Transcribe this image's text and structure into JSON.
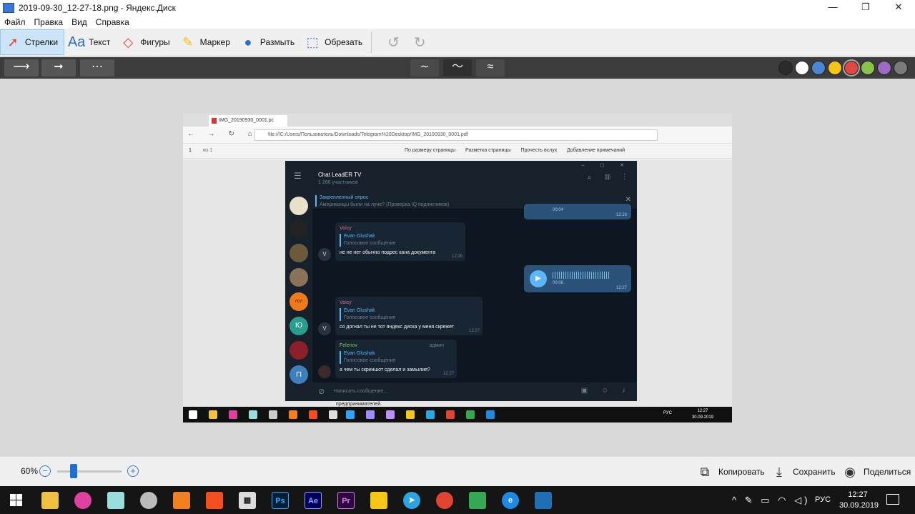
{
  "window": {
    "title": "2019-09-30_12-27-18.png - Яндекс.Диск",
    "controls": [
      "—",
      "❐",
      "✕"
    ]
  },
  "menu": [
    "Файл",
    "Правка",
    "Вид",
    "Справка"
  ],
  "toolbar": {
    "tools": [
      {
        "label": "Стрелки",
        "icon": "arrow-icon",
        "active": true
      },
      {
        "label": "Текст",
        "icon": "text-icon",
        "active": false
      },
      {
        "label": "Фигуры",
        "icon": "shapes-icon",
        "active": false
      },
      {
        "label": "Маркер",
        "icon": "marker-icon",
        "active": false
      },
      {
        "label": "Размыть",
        "icon": "blur-icon",
        "active": false
      },
      {
        "label": "Обрезать",
        "icon": "crop-icon",
        "active": false
      }
    ],
    "undo_icon": "undo-icon",
    "redo_icon": "redo-icon"
  },
  "options": {
    "arrow_styles": [
      "arrow-style-thin",
      "arrow-style-thick",
      "arrow-style-dotted"
    ],
    "stroke_widths": [
      "thin",
      "medium",
      "thick"
    ],
    "selected_width": "medium",
    "colors": [
      "#2b2b2b",
      "#ffffff",
      "#4a86d4",
      "#f5c518",
      "#e04848",
      "#8bc34a",
      "#9c6bc4",
      "#7a7a7a"
    ],
    "selected_color": "#e04848"
  },
  "screenshot": {
    "browser_tab": "IMG_20190930_0001.pc",
    "url": "file:///C:/Users/Пользователь/Downloads/Telegram%20Desktop/IMG_20190930_0001.pdf",
    "pdf_page": "1",
    "pdf_page_of": "из 1",
    "pdf_tools": [
      "По размеру страницы",
      "Разметка страницы",
      "Прочесть вслух",
      "Добавление примечаний"
    ],
    "telegram": {
      "chat_name": "Chat LeadER TV",
      "members": "1 266 участников",
      "pinned_title": "Закрепленный опрос",
      "pinned_text": "Американцы были на луне? (Проверка IQ подписчиков)",
      "messages": [
        {
          "sender": "Voicy",
          "reply_name": "Evan Glushak",
          "reply_text": "Голосовое сообщение",
          "text": "не не нет обычно подрес кана документа",
          "time": "12:26"
        },
        {
          "sender": "Voicy",
          "reply_name": "Evan Glushak",
          "reply_text": "Голосовое сообщение",
          "text": "со догнал ты не тот яндекс диска у меня скрежет",
          "time": "12:27"
        },
        {
          "sender": "Felenov",
          "role": "админ",
          "reply_name": "Evan Glushak",
          "reply_text": "Голосовое сообщение",
          "text": "а чем ты скриншот сделал и замылия?",
          "time": "12:27"
        }
      ],
      "voice_top": {
        "duration": "00:04",
        "time": "12:26"
      },
      "voice_mid": {
        "duration": "00:06",
        "time": "12:27"
      },
      "input_placeholder": "Написать сообщение...",
      "sidebar_badge": "ЛОЛ"
    },
    "pdf_text": "предпринимателей.",
    "inner_clock": {
      "time": "12:27",
      "date": "30.09.2019"
    },
    "inner_lang": "РУС"
  },
  "bottom": {
    "zoom": "60%",
    "zoom_level": 0.3,
    "copy": "Копировать",
    "save": "Сохранить",
    "share": "Поделиться"
  },
  "taskbar": {
    "lang": "РУС",
    "time": "12:27",
    "date": "30.09.2019"
  }
}
